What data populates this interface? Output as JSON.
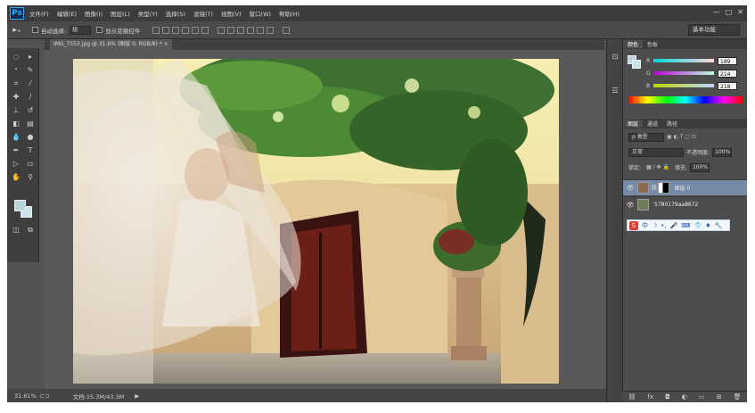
{
  "app": {
    "logo": "Ps"
  },
  "menubar": {
    "items": [
      "文件(F)",
      "编辑(E)",
      "图像(I)",
      "图层(L)",
      "类型(Y)",
      "选择(S)",
      "滤镜(T)",
      "视图(V)",
      "窗口(W)",
      "帮助(H)"
    ],
    "window_controls": [
      "—",
      "□",
      "✕"
    ]
  },
  "options": {
    "tool_glyph": "▸₊",
    "auto_select_label": "自动选择:",
    "auto_select_value": "组",
    "transform_label": "显示变换控件",
    "workspace": "基本功能"
  },
  "document": {
    "tab_label": "IMG_7553.jpg @ 31.6% (图层 0, RGB/8) * ×"
  },
  "status": {
    "zoom": "31.61%",
    "doc_size": "文档:15.3M/43.3M",
    "arrow": "▶"
  },
  "color_panel": {
    "tabs": [
      "颜色",
      "色板"
    ],
    "r_label": "R",
    "r_value": "189",
    "g_label": "G",
    "g_value": "214",
    "b_label": "B",
    "b_value": "218",
    "fg_color": "#bdd6da"
  },
  "layers_panel": {
    "tabs": [
      "图层",
      "通道",
      "路径"
    ],
    "filter": "ρ 类型",
    "blend_mode": "正常",
    "opacity_label": "不透明度:",
    "opacity_value": "100%",
    "lock_label": "锁定:",
    "fill_label": "填充:",
    "fill_value": "100%",
    "layers": [
      {
        "name": "图层 0"
      },
      {
        "name": "5780179aa8672"
      }
    ]
  },
  "ime_toolbar": {
    "logo": "S",
    "items": [
      "中",
      "☽",
      "•,",
      "🎤",
      "⌨",
      "👕",
      "♦",
      "🔧"
    ]
  },
  "panel_footer": {
    "icons": [
      "⛓",
      "fx",
      "◘",
      "◐",
      "▭",
      "⊞",
      "🗑"
    ]
  }
}
